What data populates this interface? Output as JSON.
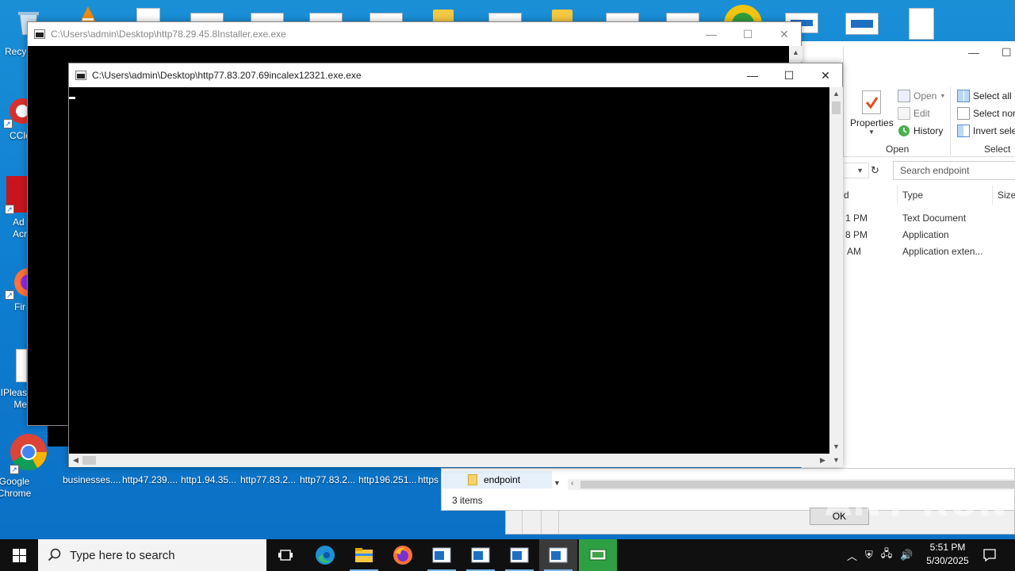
{
  "desktop": {
    "left_icons": [
      {
        "label": "Recy",
        "icon": "recycle-bin-icon"
      },
      {
        "label": "CCle",
        "icon": "ccleaner-icon"
      },
      {
        "label": "Ad\nAcr",
        "icon": "adobe-acrobat-icon"
      },
      {
        "label": "Fir",
        "icon": "firefox-icon"
      },
      {
        "label": "IPleas\nMe",
        "icon": "text-file-icon"
      },
      {
        "label": "Google\nChrome",
        "icon": "chrome-icon"
      }
    ],
    "bottom_labels": [
      "businesses....",
      "http47.239....",
      "http1.94.35...",
      "http77.83.2...",
      "http77.83.2...",
      "http196.251...",
      "https"
    ]
  },
  "console_back": {
    "title": "C:\\Users\\admin\\Desktop\\http78.29.45.8Installer.exe.exe",
    "minimize": "—",
    "maximize": "☐",
    "close": "✕"
  },
  "console_front": {
    "title": "C:\\Users\\admin\\Desktop\\http77.83.207.69incalex12321.exe.exe",
    "minimize": "—",
    "maximize": "☐",
    "close": "✕"
  },
  "explorer": {
    "minimize": "—",
    "maximize": "☐",
    "ribbon": {
      "properties": "Properties",
      "open": "Open",
      "edit": "Edit",
      "history": "History",
      "open_group": "Open",
      "select_all": "Select all",
      "select_none": "Select non",
      "invert_selection": "Invert selec",
      "select_group": "Select"
    },
    "search_placeholder": "Search endpoint",
    "columns": {
      "date": "d",
      "type": "Type",
      "size": "Size"
    },
    "rows": [
      {
        "date": "1 PM",
        "type": "Text Document"
      },
      {
        "date": "8 PM",
        "type": "Application"
      },
      {
        "date": "AM",
        "type": "Application exten..."
      }
    ],
    "nav_item": "endpoint",
    "status": "3 items",
    "dialog_ok": "OK"
  },
  "watermark": "ANY RUN",
  "taskbar": {
    "search_placeholder": "Type here to search",
    "time": "5:51 PM",
    "date": "5/30/2025"
  },
  "colors": {
    "desktop": "#0f7fd1",
    "taskbar": "#101010",
    "console": "#000000",
    "accent": "#76b9ed"
  }
}
